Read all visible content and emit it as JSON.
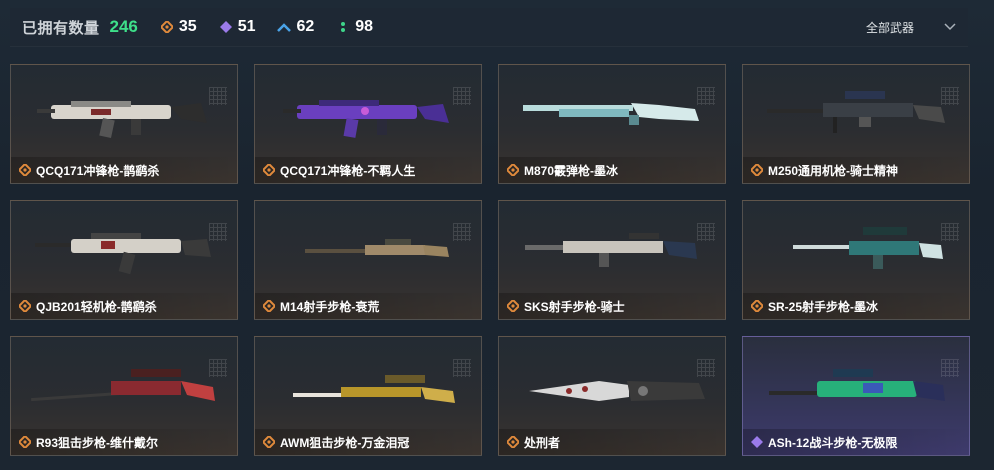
{
  "header": {
    "owned_label": "已拥有数量",
    "owned_count": "246",
    "stats": [
      {
        "icon": "orange-diamond-icon",
        "value": "35",
        "color": "#e08a3c"
      },
      {
        "icon": "purple-diamond-icon",
        "value": "51",
        "color": "#9b7bea"
      },
      {
        "icon": "blue-chevron-icon",
        "value": "62",
        "color": "#4aa3e8"
      },
      {
        "icon": "green-dots-icon",
        "value": "98",
        "color": "#3ed48a"
      }
    ],
    "filter_label": "全部武器"
  },
  "weapons": [
    {
      "name": "QCQ171冲锋枪-鹊鹞杀",
      "rarity": "orange"
    },
    {
      "name": "QCQ171冲锋枪-不羁人生",
      "rarity": "orange"
    },
    {
      "name": "M870霰弹枪-墨冰",
      "rarity": "orange"
    },
    {
      "name": "M250通用机枪-骑士精神",
      "rarity": "orange"
    },
    {
      "name": "QJB201轻机枪-鹊鹞杀",
      "rarity": "orange"
    },
    {
      "name": "M14射手步枪-衰荒",
      "rarity": "orange"
    },
    {
      "name": "SKS射手步枪-骑士",
      "rarity": "orange"
    },
    {
      "name": "SR-25射手步枪-墨冰",
      "rarity": "orange"
    },
    {
      "name": "R93狙击步枪-维什戴尔",
      "rarity": "orange"
    },
    {
      "name": "AWM狙击步枪-万金泪冠",
      "rarity": "orange"
    },
    {
      "name": "处刑者",
      "rarity": "orange"
    },
    {
      "name": "ASh-12战斗步枪-无极限",
      "rarity": "purple"
    }
  ],
  "colors": {
    "orange_rarity": "#e08a3c",
    "purple_rarity": "#9b7bea",
    "count_green": "#3ee08a"
  }
}
